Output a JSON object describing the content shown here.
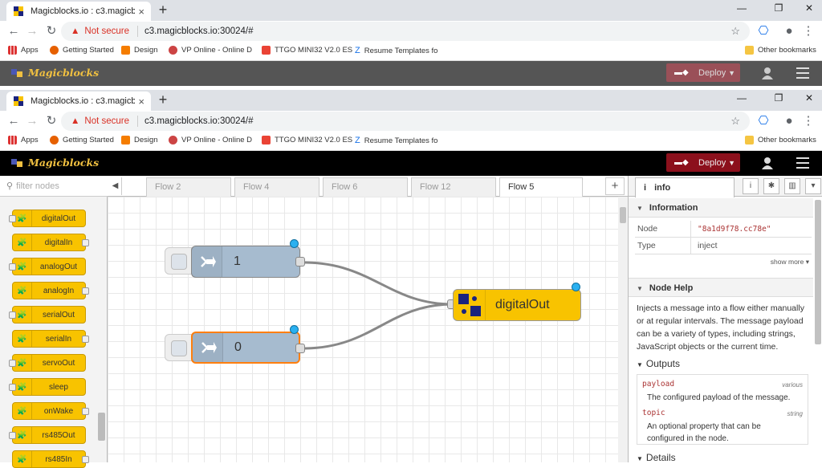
{
  "browser": {
    "tab_title": "Magicblocks.io : c3.magicblocks.i",
    "tab_close": "×",
    "new_tab": "+",
    "win_min": "—",
    "win_restore": "❐",
    "win_close": "✕",
    "not_secure": "Not secure",
    "url": "c3.magicblocks.io:30024/#",
    "bookmarks": [
      {
        "label": "Apps"
      },
      {
        "label": "Getting Started"
      },
      {
        "label": "Design"
      },
      {
        "label": "VP Online - Online D"
      },
      {
        "label": "TTGO MINI32 V2.0 ES"
      },
      {
        "label": "Resume Templates fo"
      }
    ],
    "other_bookmarks": "Other bookmarks"
  },
  "header": {
    "logo_text": "Magicblocks",
    "deploy_label": "Deploy"
  },
  "palette": {
    "filter_placeholder": "filter nodes",
    "nodes": [
      {
        "label": "digitalOut"
      },
      {
        "label": "digitalIn"
      },
      {
        "label": "analogOut"
      },
      {
        "label": "analogIn"
      },
      {
        "label": "serialOut"
      },
      {
        "label": "serialIn"
      },
      {
        "label": "servoOut"
      },
      {
        "label": "sleep"
      },
      {
        "label": "onWake"
      },
      {
        "label": "rs485Out"
      },
      {
        "label": "rs485In"
      }
    ]
  },
  "flow_tabs": [
    {
      "label": "Flow 2"
    },
    {
      "label": "Flow 4"
    },
    {
      "label": "Flow 6"
    },
    {
      "label": "Flow 12"
    },
    {
      "label": "Flow 5",
      "active": true
    }
  ],
  "canvas": {
    "inject_nodes": [
      {
        "label": "1"
      },
      {
        "label": "0"
      }
    ],
    "output_node": {
      "label": "digitalOut"
    }
  },
  "sidebar": {
    "tab_label": "info",
    "info_section": "Information",
    "rows": [
      {
        "key": "Node",
        "value": "\"8a1d9f78.cc78e\""
      },
      {
        "key": "Type",
        "value": "inject"
      }
    ],
    "show_more": "show more ▾",
    "help_section": "Node Help",
    "help_text": "Injects a message into a flow either manually or at regular intervals. The message payload can be a variety of types, including strings, JavaScript objects or the current time.",
    "outputs_heading": "Outputs",
    "outputs": [
      {
        "name": "payload",
        "type": "various",
        "desc": "The configured payload of the message."
      },
      {
        "name": "topic",
        "type": "string",
        "desc": "An optional property that can be configured in the node."
      }
    ],
    "details_heading": "Details"
  },
  "colors": {
    "deploy": "#8c101c",
    "node_yellow": "#f8c300",
    "inject_blue": "#a6bbcf",
    "selected_orange": "#ff7f0e",
    "changed_dot": "#2ab0f0"
  }
}
